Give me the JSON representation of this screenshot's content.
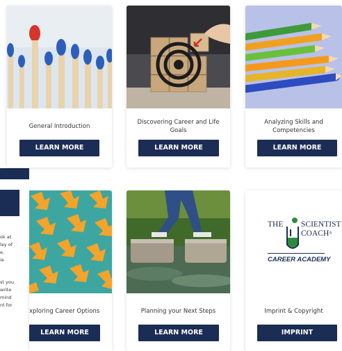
{
  "cards": [
    {
      "title": "General Introduction",
      "button": "LEARN MORE"
    },
    {
      "title": "Discovering Career and Life Goals",
      "button": "LEARN MORE"
    },
    {
      "title": "Analyzing Skills and Competencies",
      "button": "LEARN MORE"
    },
    {
      "title": "xploring Career Options",
      "button": "LEARN MORE"
    },
    {
      "title": "Planning your Next Steps",
      "button": "LEARN MORE"
    },
    {
      "title": "Imprint & Copyright",
      "button": "IMPRINT"
    }
  ],
  "logo": {
    "line1_the": "THE",
    "line1_scientist": "SCIENTIST",
    "line2_coach": "COACH",
    "line3": "CAREER ACADEMY"
  },
  "side_text": [
    "ok at",
    "lay of",
    "e,",
    "ie",
    "",
    "st you",
    "write",
    "mind",
    "nt for"
  ],
  "colors": {
    "brand_navy": "#1b2d54",
    "logo_green": "#2e8b3e"
  }
}
